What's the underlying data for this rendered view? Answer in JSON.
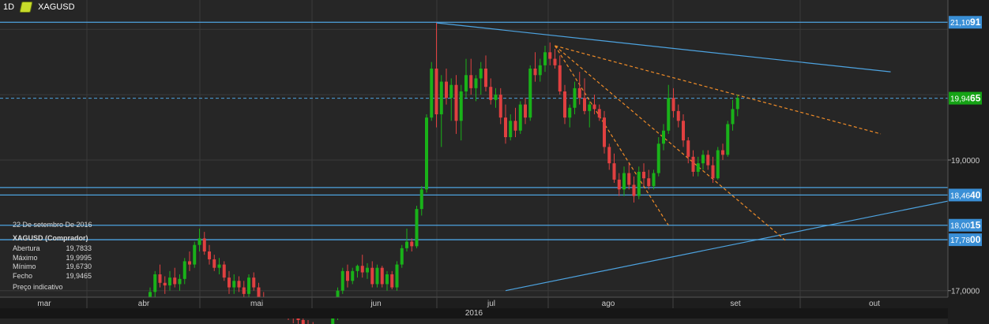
{
  "header": {
    "timeframe": "1D",
    "symbol": "XAGUSD",
    "symbol_icon": "pencil-ruler-icon"
  },
  "info_panel": {
    "date": "22 De setembro De 2016",
    "title": "XAGUSD (Comprador)",
    "rows": [
      {
        "label": "Abertura",
        "value": "19,7833"
      },
      {
        "label": "Máximo",
        "value": "19,9995"
      },
      {
        "label": "Mínimo",
        "value": "19,6730"
      },
      {
        "label": "Fecho",
        "value": "19,9465"
      }
    ],
    "footer": "Preço indicativo"
  },
  "chart_data": {
    "type": "candlestick",
    "symbol": "XAGUSD",
    "timeframe": "1D",
    "ylim": [
      16.8,
      21.3
    ],
    "y_ticks": [
      {
        "value": 17.0,
        "label": "17,0000"
      },
      {
        "value": 19.0,
        "label": "19,0000"
      }
    ],
    "x_tick_labels": [
      "mar",
      "abr",
      "mai",
      "jun",
      "jul",
      "ago",
      "set",
      "out"
    ],
    "year_label": "2016",
    "price_tags": [
      {
        "value": 21.1091,
        "label": "21,1091",
        "highlight": "91"
      },
      {
        "value": 19.9465,
        "label": "19,9465",
        "highlight": "65",
        "current": true
      },
      {
        "value": 18.464,
        "label": "18,4640",
        "highlight": "40"
      },
      {
        "value": 18.0015,
        "label": "18,0015",
        "highlight": "15"
      },
      {
        "value": 17.78,
        "label": "17,7800",
        "highlight": "00"
      }
    ],
    "horizontal_lines": [
      21.1091,
      18.5791,
      18.464,
      18.0015,
      17.78
    ],
    "colors": {
      "up": "#19b219",
      "down": "#e04040",
      "trend": "#4da3e0",
      "fib": "#f08c28",
      "current": "#4da3e0",
      "tag": "#3a8fd6",
      "tag_active": "#15a315"
    },
    "candles": [
      [
        16.85,
        17.05,
        16.75,
        16.98
      ],
      [
        16.98,
        17.3,
        16.9,
        17.25
      ],
      [
        17.25,
        17.4,
        17.05,
        17.12
      ],
      [
        17.12,
        17.22,
        16.95,
        17.08
      ],
      [
        17.08,
        17.3,
        17.0,
        17.2
      ],
      [
        17.2,
        17.35,
        17.05,
        17.1
      ],
      [
        17.1,
        17.25,
        17.0,
        17.18
      ],
      [
        17.18,
        17.5,
        17.1,
        17.45
      ],
      [
        17.45,
        17.6,
        17.3,
        17.4
      ],
      [
        17.4,
        17.75,
        17.35,
        17.7
      ],
      [
        17.7,
        17.95,
        17.6,
        17.8
      ],
      [
        17.8,
        17.9,
        17.55,
        17.6
      ],
      [
        17.6,
        17.7,
        17.4,
        17.48
      ],
      [
        17.48,
        17.55,
        17.3,
        17.35
      ],
      [
        17.35,
        17.5,
        17.25,
        17.4
      ],
      [
        17.4,
        17.45,
        17.15,
        17.2
      ],
      [
        17.2,
        17.3,
        16.95,
        17.05
      ],
      [
        17.05,
        17.25,
        16.95,
        17.15
      ],
      [
        17.15,
        17.22,
        16.98,
        17.05
      ],
      [
        17.05,
        17.15,
        16.88,
        16.95
      ],
      [
        16.95,
        17.25,
        16.9,
        17.2
      ],
      [
        17.2,
        17.28,
        17.0,
        17.05
      ],
      [
        17.05,
        17.12,
        16.85,
        16.9
      ],
      [
        16.9,
        16.98,
        16.7,
        16.78
      ],
      [
        16.78,
        16.85,
        16.65,
        16.75
      ],
      [
        16.75,
        16.82,
        16.6,
        16.7
      ],
      [
        16.7,
        16.8,
        16.58,
        16.72
      ],
      [
        16.72,
        16.8,
        16.6,
        16.68
      ],
      [
        16.68,
        16.78,
        16.55,
        16.65
      ],
      [
        16.65,
        16.72,
        16.5,
        16.6
      ],
      [
        16.6,
        16.68,
        16.45,
        16.55
      ],
      [
        16.55,
        16.62,
        16.4,
        16.48
      ],
      [
        16.48,
        16.55,
        16.35,
        16.45
      ],
      [
        16.45,
        16.52,
        16.3,
        16.4
      ],
      [
        16.4,
        16.45,
        16.25,
        16.32
      ],
      [
        16.32,
        16.4,
        16.2,
        16.3
      ],
      [
        16.3,
        16.38,
        16.18,
        16.25
      ],
      [
        16.25,
        16.65,
        16.2,
        16.6
      ],
      [
        16.6,
        17.05,
        16.55,
        17.0
      ],
      [
        17.0,
        17.35,
        16.95,
        17.3
      ],
      [
        17.3,
        17.4,
        17.05,
        17.15
      ],
      [
        17.15,
        17.35,
        17.1,
        17.3
      ],
      [
        17.3,
        17.4,
        17.2,
        17.38
      ],
      [
        17.38,
        17.55,
        17.2,
        17.28
      ],
      [
        17.28,
        17.42,
        17.18,
        17.35
      ],
      [
        17.35,
        17.45,
        17.05,
        17.1
      ],
      [
        17.1,
        17.4,
        17.05,
        17.35
      ],
      [
        17.35,
        17.38,
        17.05,
        17.1
      ],
      [
        17.1,
        17.3,
        17.0,
        17.25
      ],
      [
        17.25,
        17.3,
        17.02,
        17.05
      ],
      [
        17.05,
        17.45,
        17.0,
        17.4
      ],
      [
        17.4,
        17.7,
        17.35,
        17.65
      ],
      [
        17.65,
        17.95,
        17.6,
        17.75
      ],
      [
        17.75,
        17.8,
        17.6,
        17.68
      ],
      [
        17.68,
        18.3,
        17.65,
        18.25
      ],
      [
        18.25,
        18.6,
        18.15,
        18.55
      ],
      [
        18.55,
        19.7,
        18.5,
        19.65
      ],
      [
        19.65,
        20.5,
        19.6,
        20.4
      ],
      [
        20.4,
        21.1,
        19.5,
        19.7
      ],
      [
        19.7,
        20.3,
        19.2,
        20.2
      ],
      [
        20.2,
        20.4,
        19.85,
        19.95
      ],
      [
        19.95,
        20.25,
        19.6,
        20.15
      ],
      [
        20.15,
        20.3,
        19.4,
        19.6
      ],
      [
        19.6,
        20.15,
        19.3,
        20.05
      ],
      [
        20.05,
        20.55,
        19.95,
        20.3
      ],
      [
        20.3,
        20.55,
        20.0,
        20.1
      ],
      [
        20.1,
        20.3,
        19.9,
        20.25
      ],
      [
        20.25,
        20.5,
        20.0,
        20.4
      ],
      [
        20.4,
        20.6,
        20.05,
        20.12
      ],
      [
        20.12,
        20.25,
        19.85,
        19.92
      ],
      [
        19.92,
        20.1,
        19.8,
        20.0
      ],
      [
        20.0,
        20.1,
        19.55,
        19.65
      ],
      [
        19.65,
        19.85,
        19.25,
        19.35
      ],
      [
        19.35,
        19.7,
        19.3,
        19.6
      ],
      [
        19.6,
        19.8,
        19.35,
        19.45
      ],
      [
        19.45,
        19.9,
        19.4,
        19.85
      ],
      [
        19.85,
        19.95,
        19.55,
        19.65
      ],
      [
        19.65,
        20.45,
        19.6,
        20.4
      ],
      [
        20.4,
        20.65,
        20.2,
        20.3
      ],
      [
        20.3,
        20.55,
        20.2,
        20.45
      ],
      [
        20.45,
        20.75,
        20.35,
        20.65
      ],
      [
        20.65,
        20.8,
        20.45,
        20.55
      ],
      [
        20.55,
        20.7,
        20.4,
        20.45
      ],
      [
        20.45,
        20.6,
        20.0,
        20.05
      ],
      [
        20.05,
        20.15,
        19.55,
        19.65
      ],
      [
        19.65,
        19.85,
        19.5,
        19.8
      ],
      [
        19.8,
        20.2,
        19.7,
        20.1
      ],
      [
        20.1,
        20.35,
        19.85,
        19.95
      ],
      [
        19.95,
        20.25,
        19.7,
        19.75
      ],
      [
        19.75,
        19.9,
        19.5,
        19.85
      ],
      [
        19.85,
        20.0,
        19.7,
        19.78
      ],
      [
        19.78,
        19.85,
        19.6,
        19.65
      ],
      [
        19.65,
        19.75,
        19.1,
        19.2
      ],
      [
        19.2,
        19.25,
        18.85,
        18.95
      ],
      [
        18.95,
        19.1,
        18.65,
        18.7
      ],
      [
        18.7,
        18.8,
        18.45,
        18.55
      ],
      [
        18.55,
        18.9,
        18.45,
        18.8
      ],
      [
        18.8,
        18.95,
        18.55,
        18.62
      ],
      [
        18.62,
        18.75,
        18.35,
        18.45
      ],
      [
        18.45,
        18.9,
        18.4,
        18.82
      ],
      [
        18.82,
        18.95,
        18.6,
        18.72
      ],
      [
        18.72,
        18.85,
        18.55,
        18.6
      ],
      [
        18.6,
        18.85,
        18.55,
        18.8
      ],
      [
        18.8,
        19.35,
        18.75,
        19.25
      ],
      [
        19.25,
        19.55,
        19.15,
        19.45
      ],
      [
        19.45,
        20.15,
        19.4,
        19.95
      ],
      [
        19.95,
        20.1,
        19.65,
        19.75
      ],
      [
        19.75,
        19.85,
        19.5,
        19.6
      ],
      [
        19.6,
        19.7,
        19.2,
        19.3
      ],
      [
        19.3,
        19.35,
        18.95,
        19.05
      ],
      [
        19.05,
        19.15,
        18.75,
        18.82
      ],
      [
        18.82,
        19.05,
        18.75,
        18.95
      ],
      [
        18.95,
        19.15,
        18.85,
        19.08
      ],
      [
        19.08,
        19.15,
        18.85,
        18.92
      ],
      [
        18.92,
        19.05,
        18.65,
        18.72
      ],
      [
        18.72,
        19.2,
        18.7,
        19.15
      ],
      [
        19.15,
        19.25,
        19.0,
        19.08
      ],
      [
        19.08,
        19.6,
        19.05,
        19.55
      ],
      [
        19.55,
        19.92,
        19.45,
        19.78
      ],
      [
        19.78,
        20.0,
        19.67,
        19.95
      ]
    ],
    "x_last_index": 124
  }
}
